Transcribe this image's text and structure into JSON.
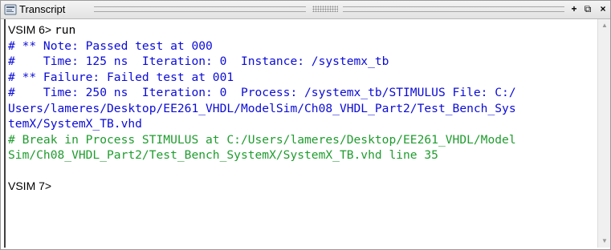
{
  "window": {
    "title": "Transcript",
    "icon": "transcript-icon",
    "buttons": {
      "add": "+",
      "undock": "⧉",
      "close": "×"
    }
  },
  "colors": {
    "command": "#000000",
    "message": "#0b0bd8",
    "break": "#1f9c2e"
  },
  "console": {
    "prompt1": "VSIM 6> ",
    "command1": "run",
    "lines": [
      "# ** Note: Passed test at 000",
      "#    Time: 125 ns  Iteration: 0  Instance: /systemx_tb",
      "# ** Failure: Failed test at 001",
      "#    Time: 250 ns  Iteration: 0  Process: /systemx_tb/STIMULUS File: C:/",
      "Users/lameres/Desktop/EE261_VHDL/ModelSim/Ch08_VHDL_Part2/Test_Bench_Sys",
      "temX/SystemX_TB.vhd"
    ],
    "break_lines": [
      "# Break in Process STIMULUS at C:/Users/lameres/Desktop/EE261_VHDL/Model",
      "Sim/Ch08_VHDL_Part2/Test_Bench_SystemX/SystemX_TB.vhd line 35"
    ],
    "prompt2": "VSIM 7>"
  }
}
